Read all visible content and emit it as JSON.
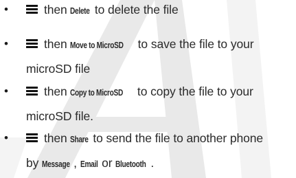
{
  "items": [
    {
      "lines": [
        {
          "segments": [
            {
              "text": "then ",
              "style": "normal"
            },
            {
              "text": "Delete",
              "style": "kw"
            },
            {
              "text": " to delete the file",
              "style": "normal"
            }
          ]
        }
      ]
    },
    {
      "lines": [
        {
          "segments": [
            {
              "text": "then ",
              "style": "normal"
            },
            {
              "text": "Move to MicroSD",
              "style": "kw"
            },
            {
              "text": " to save the file to your",
              "style": "normal"
            }
          ]
        },
        {
          "segments": [
            {
              "text": "microSD file",
              "style": "normal"
            }
          ]
        }
      ]
    },
    {
      "lines": [
        {
          "segments": [
            {
              "text": "then ",
              "style": "normal"
            },
            {
              "text": "Copy to MicroSD",
              "style": "kw"
            },
            {
              "text": " to copy the file to your",
              "style": "normal"
            }
          ]
        },
        {
          "segments": [
            {
              "text": "microSD file.",
              "style": "normal"
            }
          ]
        }
      ]
    },
    {
      "lines": [
        {
          "segments": [
            {
              "text": "then ",
              "style": "normal"
            },
            {
              "text": "Share",
              "style": "kw"
            },
            {
              "text": " to send the file to another phone",
              "style": "normal"
            }
          ]
        },
        {
          "segments": [
            {
              "text": "by ",
              "style": "normal"
            },
            {
              "text": "Message",
              "style": "kw"
            },
            {
              "text": ", ",
              "style": "normal"
            },
            {
              "text": "Email",
              "style": "kw"
            },
            {
              "text": " or ",
              "style": "normal"
            },
            {
              "text": "Bluetooth",
              "style": "kw"
            },
            {
              "text": ".",
              "style": "normal"
            }
          ]
        }
      ]
    }
  ],
  "bullet_char": "•",
  "icon": "menu-icon",
  "colors": {
    "text": "#2a2a2a",
    "watermark": "#e6e6e6",
    "icon": "#111111"
  }
}
